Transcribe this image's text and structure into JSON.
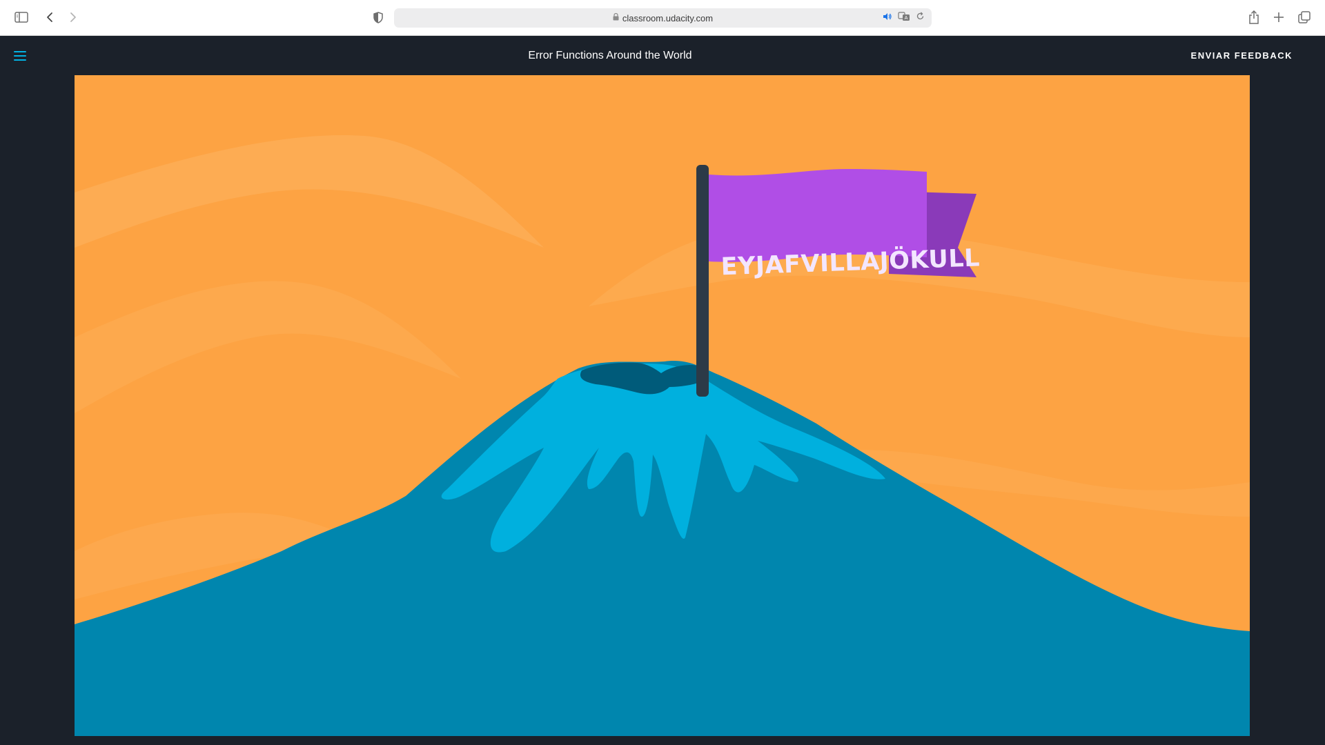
{
  "browser": {
    "url": "classroom.udacity.com",
    "icons": [
      "sidebar-icon",
      "back-icon",
      "forward-icon",
      "shield-icon",
      "lock-icon",
      "audio-icon",
      "translate-icon",
      "reload-icon",
      "share-icon",
      "new-tab-icon",
      "tabs-overview-icon"
    ]
  },
  "header": {
    "title": "Error Functions Around the World",
    "feedback_label": "ENVIAR FEEDBACK",
    "menu_icon": "hamburger-menu-icon"
  },
  "video": {
    "flag_text": "EYJAFVILLAJÖKULL"
  },
  "colors": {
    "sky": "#fda343",
    "mountain": "#0086ae",
    "snow": "#00b0de",
    "crater": "#005b7a",
    "flag": "#b04ee6",
    "flag_tail": "#8a3ab9",
    "pole": "#2c3a47",
    "accent": "#02b3e4",
    "header_bg": "#1b212a"
  }
}
